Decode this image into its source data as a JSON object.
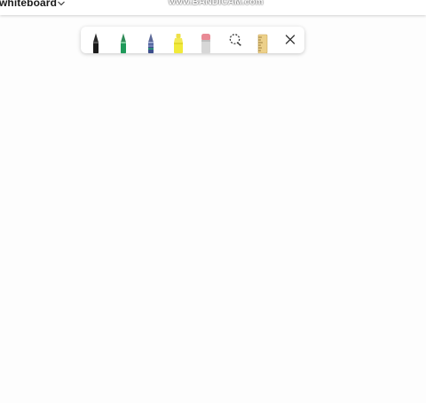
{
  "header": {
    "title": "whiteboard",
    "chevron_icon": "chevron-down-icon"
  },
  "watermark": {
    "text": "www.BANDICAM.com"
  },
  "toolbar": {
    "tools": [
      {
        "id": "pen-black",
        "icon": "pen-icon",
        "color": "#1b1b1b"
      },
      {
        "id": "pen-green",
        "icon": "pen-icon",
        "color": "#1f9a5a"
      },
      {
        "id": "pen-galaxy",
        "icon": "pen-icon",
        "color": "#3c4f8c"
      },
      {
        "id": "highlighter-yellow",
        "icon": "highlighter-icon",
        "color": "#f1ea3a"
      },
      {
        "id": "eraser",
        "icon": "eraser-icon",
        "color": "#e98a95"
      },
      {
        "id": "lasso-select",
        "icon": "lasso-icon",
        "color": "#2b2b2b"
      },
      {
        "id": "ruler",
        "icon": "ruler-icon",
        "color": "#e8c77a"
      },
      {
        "id": "close",
        "icon": "close-icon",
        "color": "#333333"
      }
    ]
  }
}
